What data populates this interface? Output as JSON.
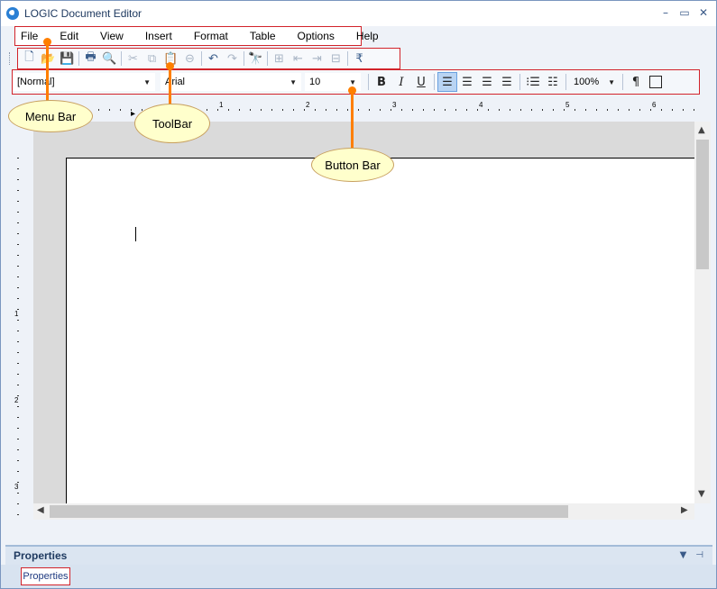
{
  "window": {
    "title": "LOGIC Document Editor",
    "minimize": "–",
    "maximize": "▭",
    "close": "✕"
  },
  "menu": {
    "items": [
      "File",
      "Edit",
      "View",
      "Insert",
      "Format",
      "Table",
      "Options",
      "Help"
    ]
  },
  "toolbar": {
    "buttons": [
      {
        "icon": "new-document-icon",
        "glyph": "🗋",
        "disabled": false
      },
      {
        "icon": "open-folder-icon",
        "glyph": "📂",
        "disabled": false
      },
      {
        "icon": "save-icon",
        "glyph": "💾",
        "disabled": false
      },
      {
        "icon": "print-icon",
        "glyph": "🖶",
        "disabled": false
      },
      {
        "icon": "print-preview-icon",
        "glyph": "🔍",
        "disabled": false
      },
      {
        "icon": "cut-icon",
        "glyph": "✂",
        "disabled": true
      },
      {
        "icon": "copy-icon",
        "glyph": "⧉",
        "disabled": true
      },
      {
        "icon": "paste-icon",
        "glyph": "📋",
        "disabled": false
      },
      {
        "icon": "delete-icon",
        "glyph": "⊖",
        "disabled": true
      },
      {
        "icon": "undo-icon",
        "glyph": "↶",
        "disabled": false
      },
      {
        "icon": "redo-icon",
        "glyph": "↷",
        "disabled": true
      },
      {
        "icon": "find-icon",
        "glyph": "🔭",
        "disabled": false
      },
      {
        "icon": "table-insert-icon",
        "glyph": "⊞",
        "disabled": true
      },
      {
        "icon": "table-left-icon",
        "glyph": "⇤",
        "disabled": true
      },
      {
        "icon": "table-right-icon",
        "glyph": "⇥",
        "disabled": true
      },
      {
        "icon": "table-delete-icon",
        "glyph": "⊟",
        "disabled": true
      },
      {
        "icon": "rupee-icon",
        "glyph": "₹",
        "disabled": false
      }
    ]
  },
  "buttonbar": {
    "style": "[Normal]",
    "font": "Arial",
    "size": "10",
    "zoom": "100%",
    "bold": "B",
    "italic": "I",
    "underline": "U"
  },
  "properties": {
    "title": "Properties",
    "tab": "Properties",
    "pin": "⊣",
    "dropdown": "▼"
  },
  "callouts": {
    "menu": "Menu Bar",
    "toolbar": "ToolBar",
    "buttonbar": "Button Bar"
  },
  "ruler": {
    "h_numbers": [
      "1",
      "2",
      "3",
      "4",
      "5",
      "6"
    ],
    "v_numbers": [
      "1",
      "2",
      "3"
    ]
  }
}
